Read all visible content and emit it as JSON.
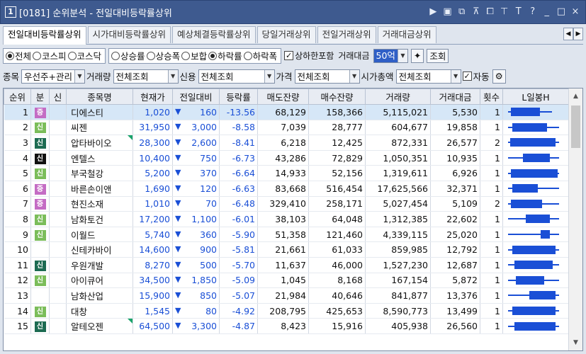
{
  "window": {
    "number": "1",
    "title": "[0181] 순위분석 - 전일대비등락률상위"
  },
  "title_icons": [
    "▶",
    "▣",
    "⧉",
    "⊼",
    "⧠",
    "⊤",
    "T",
    "?",
    "_",
    "□",
    "×"
  ],
  "tabs": [
    "전일대비등락률상위",
    "시가대비등락률상위",
    "예상체결등락률상위",
    "당일거래상위",
    "전일거래상위",
    "거래대금상위"
  ],
  "tab_arrows": [
    "◀",
    "▶"
  ],
  "market": {
    "options": [
      "전체",
      "코스피",
      "코스닥"
    ],
    "selected": 0
  },
  "direction": {
    "options": [
      "상승률",
      "상승폭",
      "보합",
      "하락률",
      "하락폭"
    ],
    "selected": 3
  },
  "limit_include": {
    "label": "상하한포함",
    "checked": true
  },
  "amount": {
    "label": "거래대금",
    "value": "50억"
  },
  "query_button": "조회",
  "filters": {
    "stock_label": "종목",
    "stock_value": "우선주+관리",
    "volume_label": "거래량",
    "volume_value": "전체조회",
    "credit_label": "신용",
    "credit_value": "전체조회",
    "price_label": "가격",
    "price_value": "전체조회",
    "cap_label": "시가총액",
    "cap_value": "전체조회",
    "auto_label": "자동",
    "auto_checked": true
  },
  "columns": [
    "순위",
    "분",
    "신",
    "종목명",
    "현재가",
    "전일대비",
    "등락률",
    "매도잔량",
    "매수잔량",
    "거래량",
    "거래대금",
    "횟수",
    "L일봉H"
  ],
  "rows": [
    {
      "rank": "1",
      "div": "증",
      "div_type": "kospi",
      "name": "디에스티",
      "price": "1,020",
      "change": "160",
      "rate": "-13.56",
      "sell": "68,129",
      "buy": "158,366",
      "volume": "5,115,021",
      "amount": "5,530",
      "count": "1",
      "candle": {
        "low": 0.05,
        "high": 0.78,
        "open": 0.1,
        "close": 0.58
      }
    },
    {
      "rank": "2",
      "div": "신",
      "div_type": "kosdaq",
      "name": "씨젠",
      "price": "31,950",
      "change": "3,000",
      "rate": "-8.58",
      "sell": "7,039",
      "buy": "28,777",
      "volume": "604,677",
      "amount": "19,858",
      "count": "1",
      "candle": {
        "low": 0.05,
        "high": 0.9,
        "open": 0.12,
        "close": 0.7
      }
    },
    {
      "rank": "3",
      "div": "신",
      "div_type": "dark",
      "name": "압타바이오",
      "tri": true,
      "price": "28,300",
      "change": "2,600",
      "rate": "-8.41",
      "sell": "6,218",
      "buy": "12,425",
      "volume": "872,331",
      "amount": "26,577",
      "count": "2",
      "candle": {
        "low": 0.05,
        "high": 0.9,
        "open": 0.08,
        "close": 0.85
      }
    },
    {
      "rank": "4",
      "div": "신",
      "div_type": "black",
      "name": "엔텔스",
      "price": "10,400",
      "change": "750",
      "rate": "-6.73",
      "sell": "43,286",
      "buy": "72,829",
      "volume": "1,050,351",
      "amount": "10,935",
      "count": "1",
      "candle": {
        "low": 0.05,
        "high": 0.9,
        "open": 0.3,
        "close": 0.75
      }
    },
    {
      "rank": "5",
      "div": "신",
      "div_type": "kosdaq",
      "name": "부국철강",
      "price": "5,200",
      "change": "370",
      "rate": "-6.64",
      "sell": "14,933",
      "buy": "52,156",
      "volume": "1,319,611",
      "amount": "6,926",
      "count": "1",
      "candle": {
        "low": 0.05,
        "high": 0.9,
        "open": 0.1,
        "close": 0.88
      }
    },
    {
      "rank": "6",
      "div": "증",
      "div_type": "kospi",
      "name": "바른손이앤",
      "price": "1,690",
      "change": "120",
      "rate": "-6.63",
      "sell": "83,668",
      "buy": "516,454",
      "volume": "17,625,566",
      "amount": "32,371",
      "count": "1",
      "candle": {
        "low": 0.05,
        "high": 0.9,
        "open": 0.12,
        "close": 0.55
      }
    },
    {
      "rank": "7",
      "div": "증",
      "div_type": "kospi",
      "name": "현진소재",
      "price": "1,010",
      "change": "70",
      "rate": "-6.48",
      "sell": "329,410",
      "buy": "258,171",
      "volume": "5,027,454",
      "amount": "5,109",
      "count": "2",
      "candle": {
        "low": 0.05,
        "high": 0.9,
        "open": 0.1,
        "close": 0.62
      }
    },
    {
      "rank": "8",
      "div": "신",
      "div_type": "kosdaq",
      "name": "남화토건",
      "price": "17,200",
      "change": "1,100",
      "rate": "-6.01",
      "sell": "38,103",
      "buy": "64,048",
      "volume": "1,312,385",
      "amount": "22,602",
      "count": "1",
      "candle": {
        "low": 0.05,
        "high": 0.9,
        "open": 0.35,
        "close": 0.75
      }
    },
    {
      "rank": "9",
      "div": "신",
      "div_type": "kosdaq",
      "name": "이월드",
      "price": "5,740",
      "change": "360",
      "rate": "-5.90",
      "sell": "51,358",
      "buy": "121,460",
      "volume": "4,339,115",
      "amount": "25,020",
      "count": "1",
      "candle": {
        "low": 0.05,
        "high": 0.9,
        "open": 0.6,
        "close": 0.75
      }
    },
    {
      "rank": "10",
      "div": "",
      "div_type": "",
      "name": "신테카바이",
      "price": "14,600",
      "change": "900",
      "rate": "-5.81",
      "sell": "21,661",
      "buy": "61,033",
      "volume": "859,985",
      "amount": "12,792",
      "count": "1",
      "candle": {
        "low": 0.05,
        "high": 0.9,
        "open": 0.12,
        "close": 0.85
      }
    },
    {
      "rank": "11",
      "div": "신",
      "div_type": "dark",
      "name": "우원개발",
      "price": "8,270",
      "change": "500",
      "rate": "-5.70",
      "sell": "11,637",
      "buy": "46,000",
      "volume": "1,527,230",
      "amount": "12,687",
      "count": "1",
      "candle": {
        "low": 0.05,
        "high": 0.9,
        "open": 0.15,
        "close": 0.8
      }
    },
    {
      "rank": "12",
      "div": "신",
      "div_type": "kosdaq",
      "name": "아이큐어",
      "price": "34,500",
      "change": "1,850",
      "rate": "-5.09",
      "sell": "1,045",
      "buy": "8,168",
      "volume": "167,154",
      "amount": "5,872",
      "count": "1",
      "candle": {
        "low": 0.05,
        "high": 0.9,
        "open": 0.18,
        "close": 0.65
      }
    },
    {
      "rank": "13",
      "div": "",
      "div_type": "",
      "name": "남화산업",
      "price": "15,900",
      "change": "850",
      "rate": "-5.07",
      "sell": "21,984",
      "buy": "40,646",
      "volume": "841,877",
      "amount": "13,376",
      "count": "1",
      "candle": {
        "low": 0.05,
        "high": 0.9,
        "open": 0.4,
        "close": 0.85
      }
    },
    {
      "rank": "14",
      "div": "신",
      "div_type": "kosdaq",
      "name": "대창",
      "price": "1,545",
      "change": "80",
      "rate": "-4.92",
      "sell": "208,795",
      "buy": "425,653",
      "volume": "8,590,773",
      "amount": "13,499",
      "count": "1",
      "candle": {
        "low": 0.05,
        "high": 0.9,
        "open": 0.12,
        "close": 0.85
      }
    },
    {
      "rank": "15",
      "div": "신",
      "div_type": "dark",
      "name": "알테오젠",
      "tri": true,
      "price": "64,500",
      "change": "3,300",
      "rate": "-4.87",
      "sell": "8,423",
      "buy": "15,916",
      "volume": "405,938",
      "amount": "26,560",
      "count": "1",
      "candle": {
        "low": 0.05,
        "high": 0.9,
        "open": 0.15,
        "close": 0.85
      }
    }
  ],
  "scrollbar": {
    "up": "▲",
    "down": "▼"
  }
}
